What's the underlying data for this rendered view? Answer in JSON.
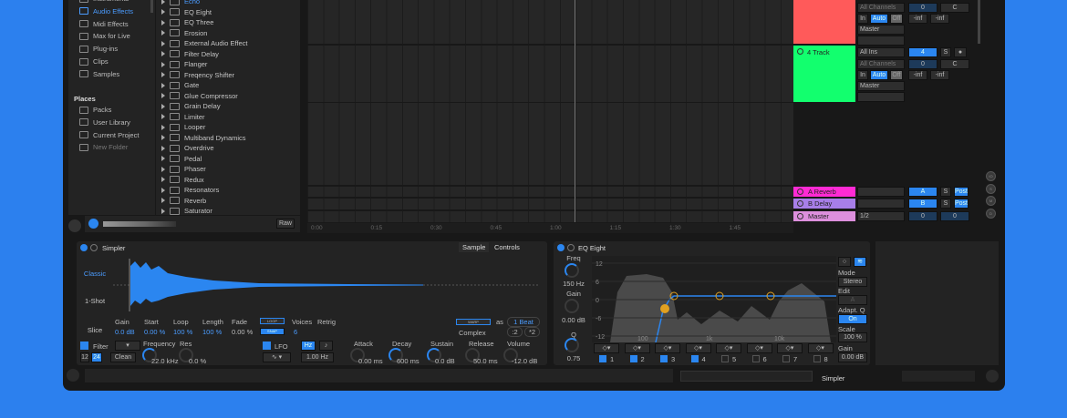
{
  "browser": {
    "categories": [
      {
        "label": "Instruments"
      },
      {
        "label": "Audio Effects",
        "active": true
      },
      {
        "label": "Midi Effects"
      },
      {
        "label": "Max for Live"
      },
      {
        "label": "Plug-ins"
      },
      {
        "label": "Clips"
      },
      {
        "label": "Samples"
      }
    ],
    "places_title": "Places",
    "places": [
      {
        "label": "Packs"
      },
      {
        "label": "User Library"
      },
      {
        "label": "Current Project"
      },
      {
        "label": "New Folder"
      }
    ],
    "items": [
      "Echo",
      "EQ Eight",
      "EQ Three",
      "Erosion",
      "External Audio Effect",
      "Filter Delay",
      "Flanger",
      "Freqency Shifter",
      "Gate",
      "Glue Compressor",
      "Grain Delay",
      "Limiter",
      "Looper",
      "Multiband Dynamics",
      "Overdrive",
      "Pedal",
      "Phaser",
      "Redux",
      "Resonators",
      "Reverb",
      "Saturator"
    ],
    "raw_label": "Raw"
  },
  "tracks": [
    {
      "name": "",
      "color": "#ff5a5a",
      "input": "",
      "channel": "All Channels",
      "mon": [
        "In",
        "Auto",
        "Off"
      ],
      "output": "Master",
      "vol": "0",
      "pan": "C",
      "meters": [
        "-inf",
        "-inf"
      ]
    },
    {
      "name": "4 Track",
      "color": "#12ff6e",
      "input": "All Ins",
      "channel": "All Channels",
      "mon": [
        "In",
        "Auto",
        "Off"
      ],
      "output": "Master",
      "num": "4",
      "solo": "S",
      "vol": "0",
      "pan": "C",
      "meters": [
        "-inf",
        "-inf"
      ]
    }
  ],
  "returns": [
    {
      "name": "A Reverb",
      "color": "#ff2ad4",
      "send": "A",
      "solo": "S",
      "post": "Post"
    },
    {
      "name": "B Delay",
      "color": "#a77ee8",
      "send": "B",
      "solo": "S",
      "post": "Post"
    },
    {
      "name": "Master",
      "color": "#dd8fdd",
      "out": "1/2",
      "vol": "0",
      "pan": "0"
    }
  ],
  "timeline": [
    "0:00",
    "0:15",
    "0:30",
    "0:45",
    "1:00",
    "1:15",
    "1:30",
    "1:45"
  ],
  "right_buttons": [
    "IO",
    "S",
    "M",
    "D"
  ],
  "simpler": {
    "title": "Simpler",
    "tabs": [
      "Sample",
      "Controls"
    ],
    "modes": [
      "Classic",
      "1-Shot",
      "Slice"
    ],
    "params": [
      {
        "label": "Gain",
        "value": "0.0 dB"
      },
      {
        "label": "Start",
        "value": "0.00 %"
      },
      {
        "label": "Loop",
        "value": "100 %"
      },
      {
        "label": "Length",
        "value": "100 %"
      },
      {
        "label": "Fade",
        "value": "0.00 %"
      }
    ],
    "loop_btn": "LOOP",
    "snap_btn": "SNAP",
    "voices_label": "Voices",
    "voices_value": "6",
    "retrig_label": "Retrig",
    "warp_btn": "WARP",
    "as_label": "as",
    "beat": "1 Beat",
    "complex": "Complex",
    "half": ":2",
    "double": "*2",
    "filter_label": "Filter",
    "slope": [
      "12",
      "24"
    ],
    "clean": "Clean",
    "frequency_label": "Frequency",
    "frequency_value": "22.0 kHz",
    "res_label": "Res",
    "res_value": "0.0 %",
    "lfo_label": "LFO",
    "hz": "Hz",
    "lfo_rate": "1.00 Hz",
    "env": [
      {
        "label": "Attack",
        "value": "0.00 ms"
      },
      {
        "label": "Decay",
        "value": "600 ms"
      },
      {
        "label": "Sustain",
        "value": "0.0 dB"
      },
      {
        "label": "Release",
        "value": "50.0 ms"
      },
      {
        "label": "Volume",
        "value": "-12.0 dB"
      }
    ]
  },
  "eq": {
    "title": "EQ Eight",
    "freq_label": "Freq",
    "freq_value": "150 Hz",
    "gain_label": "Gain",
    "gain_value": "0.00 dB",
    "q_label": "Q",
    "q_value": "0.75",
    "db_ticks": [
      "12",
      "6",
      "0",
      "-6",
      "-12"
    ],
    "freq_ticks": [
      "100",
      "1k",
      "10k"
    ],
    "bands": [
      {
        "n": "1",
        "on": true
      },
      {
        "n": "2",
        "on": true
      },
      {
        "n": "3",
        "on": true
      },
      {
        "n": "4",
        "on": true
      },
      {
        "n": "5",
        "on": false
      },
      {
        "n": "6",
        "on": false
      },
      {
        "n": "7",
        "on": false
      },
      {
        "n": "8",
        "on": false
      }
    ],
    "mode_label": "Mode",
    "mode_value": "Stereo",
    "edit_label": "Edit",
    "edit_value": "A",
    "adapt_label": "Adapt. Q",
    "adapt_value": "On",
    "scale_label": "Scale",
    "scale_value": "100 %",
    "out_gain_label": "Gain",
    "out_gain_value": "0.00 dB"
  },
  "status": {
    "device": "Simpler"
  },
  "colors": {
    "accent": "#2b86f0",
    "background": "#2c80ee"
  }
}
